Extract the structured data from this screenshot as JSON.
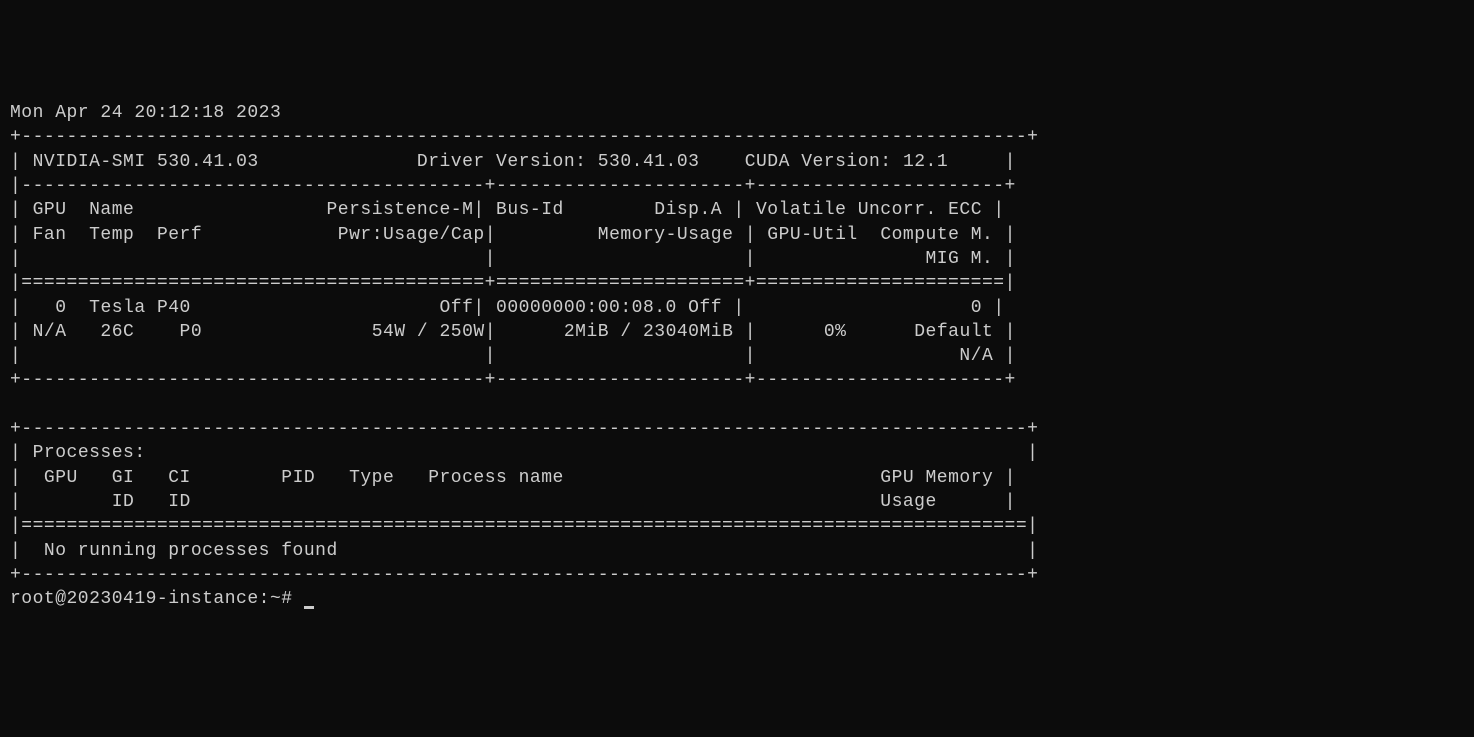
{
  "timestamp": "Mon Apr 24 20:12:18 2023",
  "header": {
    "smi_label": "NVIDIA-SMI",
    "smi_version": "530.41.03",
    "driver_label": "Driver Version:",
    "driver_version": "530.41.03",
    "cuda_label": "CUDA Version:",
    "cuda_version": "12.1"
  },
  "column_headers": {
    "gpu": "GPU",
    "name": "Name",
    "persistence": "Persistence-M",
    "bus_id": "Bus-Id",
    "disp_a": "Disp.A",
    "volatile": "Volatile Uncorr. ECC",
    "fan": "Fan",
    "temp": "Temp",
    "perf": "Perf",
    "pwr": "Pwr:Usage/Cap",
    "memory_usage": "Memory-Usage",
    "gpu_util": "GPU-Util",
    "compute_m": "Compute M.",
    "mig_m": "MIG M."
  },
  "gpu": {
    "index": "0",
    "name": "Tesla P40",
    "persistence": "Off",
    "bus_id": "00000000:00:08.0",
    "disp_a": "Off",
    "ecc": "0",
    "fan": "N/A",
    "temp": "26C",
    "perf": "P0",
    "pwr_usage": "54W",
    "pwr_cap": "250W",
    "mem_used": "2MiB",
    "mem_total": "23040MiB",
    "gpu_util": "0%",
    "compute_m": "Default",
    "mig_m": "N/A"
  },
  "processes": {
    "title": "Processes:",
    "headers": {
      "gpu": "GPU",
      "gi": "GI",
      "ci": "CI",
      "pid": "PID",
      "type": "Type",
      "process_name": "Process name",
      "gpu_memory": "GPU Memory",
      "id": "ID",
      "usage": "Usage"
    },
    "message": "No running processes found"
  },
  "prompt": "root@20230419-instance:~#"
}
